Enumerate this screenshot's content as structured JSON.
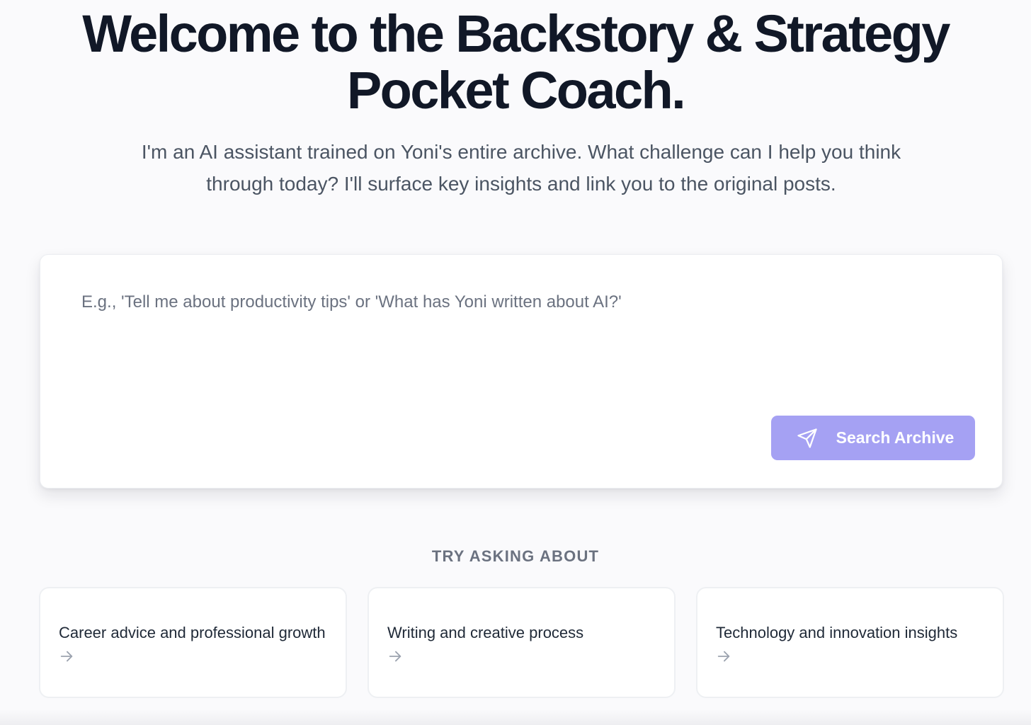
{
  "hero": {
    "title_line1": "Welcome to the Backstory & Strategy",
    "title_line2": "Pocket Coach.",
    "subtitle": "I'm an AI assistant trained on Yoni's entire archive. What challenge can I help you think through today? I'll surface key insights and link you to the original posts."
  },
  "search": {
    "placeholder": "E.g., 'Tell me about productivity tips' or 'What has Yoni written about AI?'",
    "value": "",
    "button_label": "Search Archive",
    "button_icon": "send-icon"
  },
  "suggestions": {
    "heading": "TRY ASKING ABOUT",
    "items": [
      {
        "label": "Career advice and professional growth",
        "icon": "arrow-right-icon"
      },
      {
        "label": "Writing and creative process",
        "icon": "arrow-right-icon"
      },
      {
        "label": "Technology and innovation insights",
        "icon": "arrow-right-icon"
      }
    ]
  },
  "colors": {
    "background": "#fafafc",
    "heading": "#111827",
    "body_text": "#4b5563",
    "placeholder": "#6b7280",
    "accent_button": "#a5a1f3",
    "card_border": "#eef0f3"
  }
}
